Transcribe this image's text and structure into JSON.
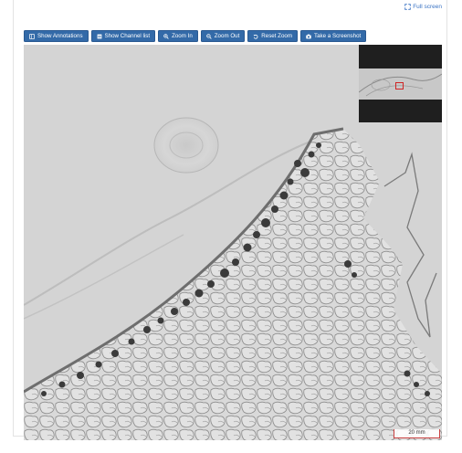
{
  "header": {
    "fullscreen_label": "Full screen",
    "fullscreen_icon": "expand-icon"
  },
  "toolbar": {
    "buttons": [
      {
        "label": "Show Annotations",
        "icon": "annotations-icon"
      },
      {
        "label": "Show Channel list",
        "icon": "channel-list-icon"
      },
      {
        "label": "Zoom In",
        "icon": "zoom-in-icon"
      },
      {
        "label": "Zoom Out",
        "icon": "zoom-out-icon"
      },
      {
        "label": "Reset Zoom",
        "icon": "reset-icon"
      },
      {
        "label": "Take a Screenshot",
        "icon": "camera-icon"
      }
    ],
    "button_color": "#336aa8"
  },
  "viewer": {
    "scale_label": "20 mm",
    "scale_color": "#c84040",
    "roi_color": "#d02424"
  }
}
